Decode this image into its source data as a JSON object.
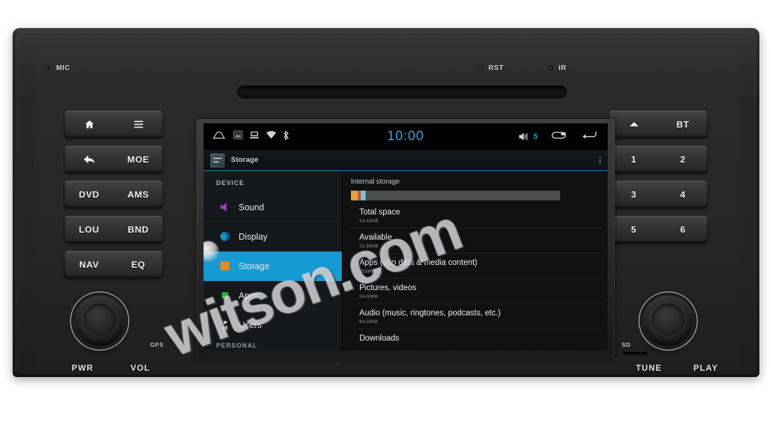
{
  "device": {
    "top_labels": {
      "mic": "MIC",
      "rst": "RST",
      "ir": "IR"
    },
    "left_buttons": [
      {
        "left": "home-icon",
        "right": "menu-icon",
        "left_text": "",
        "right_text": ""
      },
      {
        "left": "back-icon",
        "right": "MOE",
        "left_text": "",
        "right_text": "MOE"
      },
      {
        "left": "DVD",
        "right": "AMS",
        "left_text": "DVD",
        "right_text": "AMS"
      },
      {
        "left": "LOU",
        "right": "BND",
        "left_text": "LOU",
        "right_text": "BND"
      },
      {
        "left": "NAV",
        "right": "EQ",
        "left_text": "NAV",
        "right_text": "EQ"
      }
    ],
    "right_buttons": [
      {
        "left_text": "",
        "right_text": "BT",
        "left_icon": "eject-icon"
      },
      {
        "left_text": "1",
        "right_text": "2"
      },
      {
        "left_text": "3",
        "right_text": "4"
      },
      {
        "left_text": "5",
        "right_text": "6"
      }
    ],
    "knob_labels": {
      "power": "PWR",
      "volume": "VOL",
      "tune": "TUNE",
      "play": "PLAY",
      "gps": "GPS",
      "sd": "SD"
    }
  },
  "screen": {
    "status_bar": {
      "clock": "10:00",
      "volume_level": "5",
      "left_icons": [
        "home-icon",
        "screenshot-icon",
        "usb-icon",
        "wifi-icon",
        "bluetooth-icon"
      ],
      "right_icons": [
        "volume-icon",
        "recents-icon",
        "back-icon"
      ]
    },
    "action_bar": {
      "title": "Storage",
      "icon": "settings-icon",
      "overflow": "overflow-menu-icon"
    },
    "sidebar": {
      "section_header": "DEVICE",
      "next_section_header": "PERSONAL",
      "items": [
        {
          "label": "Sound",
          "icon": "sound-icon",
          "selected": false
        },
        {
          "label": "Display",
          "icon": "display-icon",
          "selected": false
        },
        {
          "label": "Storage",
          "icon": "storage-icon",
          "selected": true
        },
        {
          "label": "Apps",
          "icon": "apps-icon",
          "selected": false
        },
        {
          "label": "Users",
          "icon": "users-icon",
          "selected": false
        }
      ]
    },
    "storage": {
      "title": "Internal storage",
      "usage_segments": [
        {
          "name": "apps",
          "color": "#e0a03a",
          "percent": 3.2
        },
        {
          "name": "pictures",
          "color": "#c8513f",
          "percent": 1.4
        },
        {
          "name": "audio",
          "color": "#6fc6d8",
          "percent": 2.4
        },
        {
          "name": "free",
          "color": "#4a4d50",
          "percent": 93.0
        }
      ],
      "rows": [
        {
          "label": "Total space",
          "value": "13.43GB"
        },
        {
          "label": "Available",
          "value": "12.95GB"
        },
        {
          "label": "Apps (app data & media content)",
          "value": "253MB"
        },
        {
          "label": "Pictures, videos",
          "value": "24.00KB"
        },
        {
          "label": "Audio (music, ringtones, podcasts, etc.)",
          "value": "84.00KB"
        },
        {
          "label": "Downloads",
          "value": ""
        }
      ]
    }
  },
  "watermark": {
    "text": "witson.com"
  },
  "colors": {
    "accent_blue": "#169ad3",
    "clock_blue": "#2fa8d8",
    "bezel": "#2b2b2b",
    "screen_bg": "#0f1113"
  }
}
